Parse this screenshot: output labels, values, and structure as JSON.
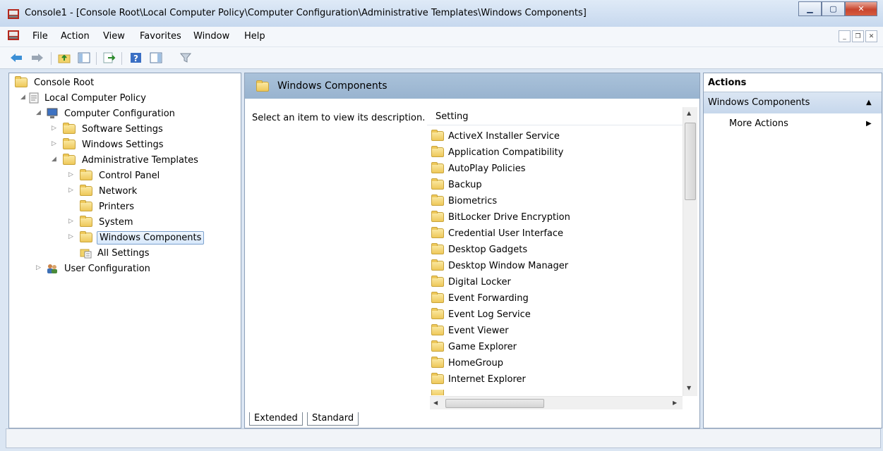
{
  "window": {
    "title": "Console1 - [Console Root\\Local Computer Policy\\Computer Configuration\\Administrative Templates\\Windows Components]"
  },
  "menu": [
    "File",
    "Action",
    "View",
    "Favorites",
    "Window",
    "Help"
  ],
  "tree": {
    "root": "Console Root",
    "local_policy": "Local Computer Policy",
    "computer_config": "Computer Configuration",
    "software_settings": "Software Settings",
    "windows_settings": "Windows Settings",
    "admin_templates": "Administrative Templates",
    "control_panel": "Control Panel",
    "network": "Network",
    "printers": "Printers",
    "system": "System",
    "windows_components": "Windows Components",
    "all_settings": "All Settings",
    "user_config": "User Configuration"
  },
  "main": {
    "header": "Windows Components",
    "description": "Select an item to view its description.",
    "column_header": "Setting",
    "items": [
      "ActiveX Installer Service",
      "Application Compatibility",
      "AutoPlay Policies",
      "Backup",
      "Biometrics",
      "BitLocker Drive Encryption",
      "Credential User Interface",
      "Desktop Gadgets",
      "Desktop Window Manager",
      "Digital Locker",
      "Event Forwarding",
      "Event Log Service",
      "Event Viewer",
      "Game Explorer",
      "HomeGroup",
      "Internet Explorer"
    ],
    "tabs": {
      "extended": "Extended",
      "standard": "Standard"
    }
  },
  "actions": {
    "title": "Actions",
    "section": "Windows Components",
    "more": "More Actions"
  }
}
